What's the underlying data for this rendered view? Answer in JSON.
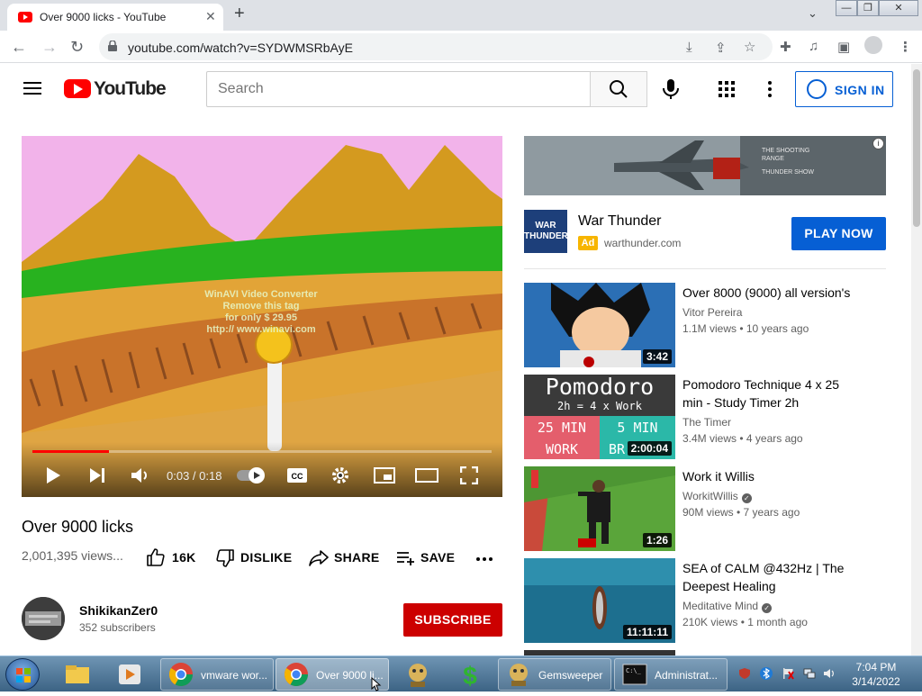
{
  "browser": {
    "tab_title": "Over 9000 licks - YouTube",
    "url": "youtube.com/watch?v=SYDWMSRbAyE"
  },
  "youtube": {
    "logo_text": "YouTube",
    "search_placeholder": "Search",
    "signin_label": "SIGN IN"
  },
  "player": {
    "current_time": "0:03",
    "duration": "0:18",
    "time_display": "0:03 / 0:18",
    "progress_fraction": 0.167,
    "watermark_lines": [
      "WinAVI Video Converter",
      "Remove this tag",
      "for only $ 29.95",
      "http:// www.winavi.com"
    ]
  },
  "video": {
    "title": "Over 9000 licks",
    "views": "2,001,395 views...",
    "likes": "16K",
    "dislike_label": "DISLIKE",
    "share_label": "SHARE",
    "save_label": "SAVE",
    "channel_name": "ShikikanZer0",
    "subscribers": "352 subscribers",
    "subscribe_label": "SUBSCRIBE"
  },
  "ad": {
    "banner_lines": [
      "THE SHOOTING",
      "RANGE",
      "THUNDER SHOW"
    ],
    "logo_text": "WAR THUNDER",
    "title": "War Thunder",
    "badge": "Ad",
    "domain": "warthunder.com",
    "cta": "PLAY NOW"
  },
  "recommendations": [
    {
      "title": "Over 8000 (9000) all version's",
      "channel": "Vitor Pereira",
      "verified": false,
      "meta": "1.1M views • 10 years ago",
      "duration": "3:42"
    },
    {
      "title": "Pomodoro Technique 4 x 25 min - Study Timer 2h",
      "channel": "The Timer",
      "verified": false,
      "meta": "3.4M views • 4 years ago",
      "duration": "2:00:04",
      "thumb_text": {
        "top": "Pomodoro",
        "sub": "2h = 4 x Work",
        "left1": "25 MIN",
        "left2": "WORK",
        "right1": "5 MIN",
        "right2": "BR"
      }
    },
    {
      "title": "Work it Willis",
      "channel": "WorkitWillis",
      "verified": true,
      "meta": "90M views • 7 years ago",
      "duration": "1:26"
    },
    {
      "title": "SEA of CALM @432Hz | The Deepest Healing",
      "channel": "Meditative Mind",
      "verified": true,
      "meta": "210K views • 1 month ago",
      "duration": "11:11:11"
    }
  ],
  "taskbar": {
    "tasks": [
      {
        "label": "vmware wor..."
      },
      {
        "label": "Over 9000 li..."
      },
      {
        "label": "Gemsweeper"
      },
      {
        "label": "Administrat..."
      }
    ],
    "time": "7:04 PM",
    "date": "3/14/2022"
  }
}
